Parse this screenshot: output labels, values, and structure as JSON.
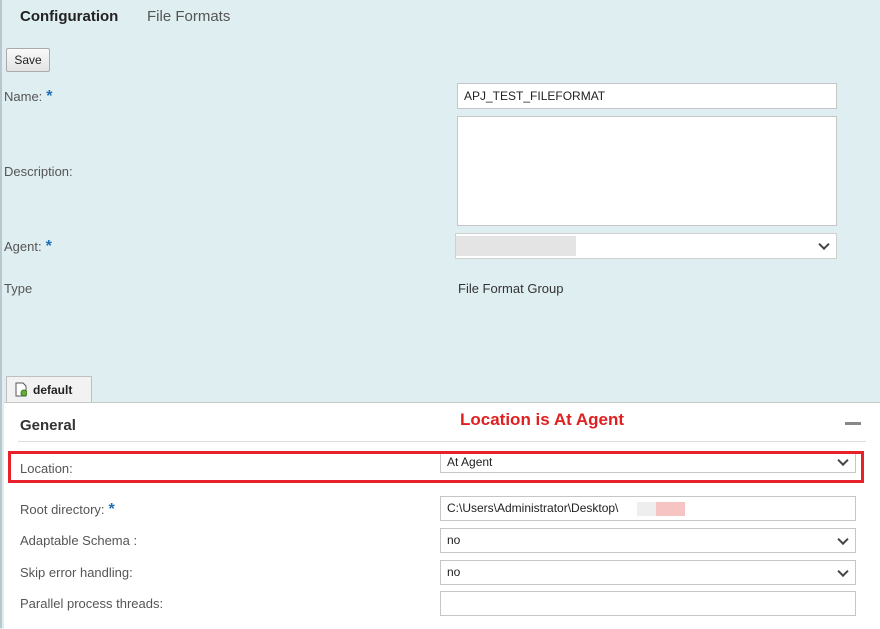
{
  "tabs": {
    "configuration": "Configuration",
    "file_formats": "File Formats"
  },
  "toolbar": {
    "save_label": "Save"
  },
  "form": {
    "name_label": "Name:",
    "name_value": "APJ_TEST_FILEFORMAT",
    "description_label": "Description:",
    "description_value": "",
    "agent_label": "Agent:",
    "agent_value": "",
    "type_label": "Type",
    "type_value": "File Format Group",
    "required_marker": "*"
  },
  "group_tab": {
    "label": "default",
    "icon": "document-gear-icon"
  },
  "general": {
    "title": "General",
    "annotation": "Location is At Agent",
    "location_label": "Location:",
    "location_value": "At Agent",
    "root_directory_label": "Root directory:",
    "root_directory_value": "C:\\Users\\Administrator\\Desktop\\",
    "adaptable_schema_label": "Adaptable Schema :",
    "adaptable_schema_value": "no",
    "skip_error_label": "Skip error handling:",
    "skip_error_value": "no",
    "parallel_threads_label": "Parallel process threads:",
    "parallel_threads_value": ""
  },
  "colors": {
    "accent_required": "#1f6fb5",
    "annotation_red": "#e02020",
    "background": "#dfeef1"
  }
}
